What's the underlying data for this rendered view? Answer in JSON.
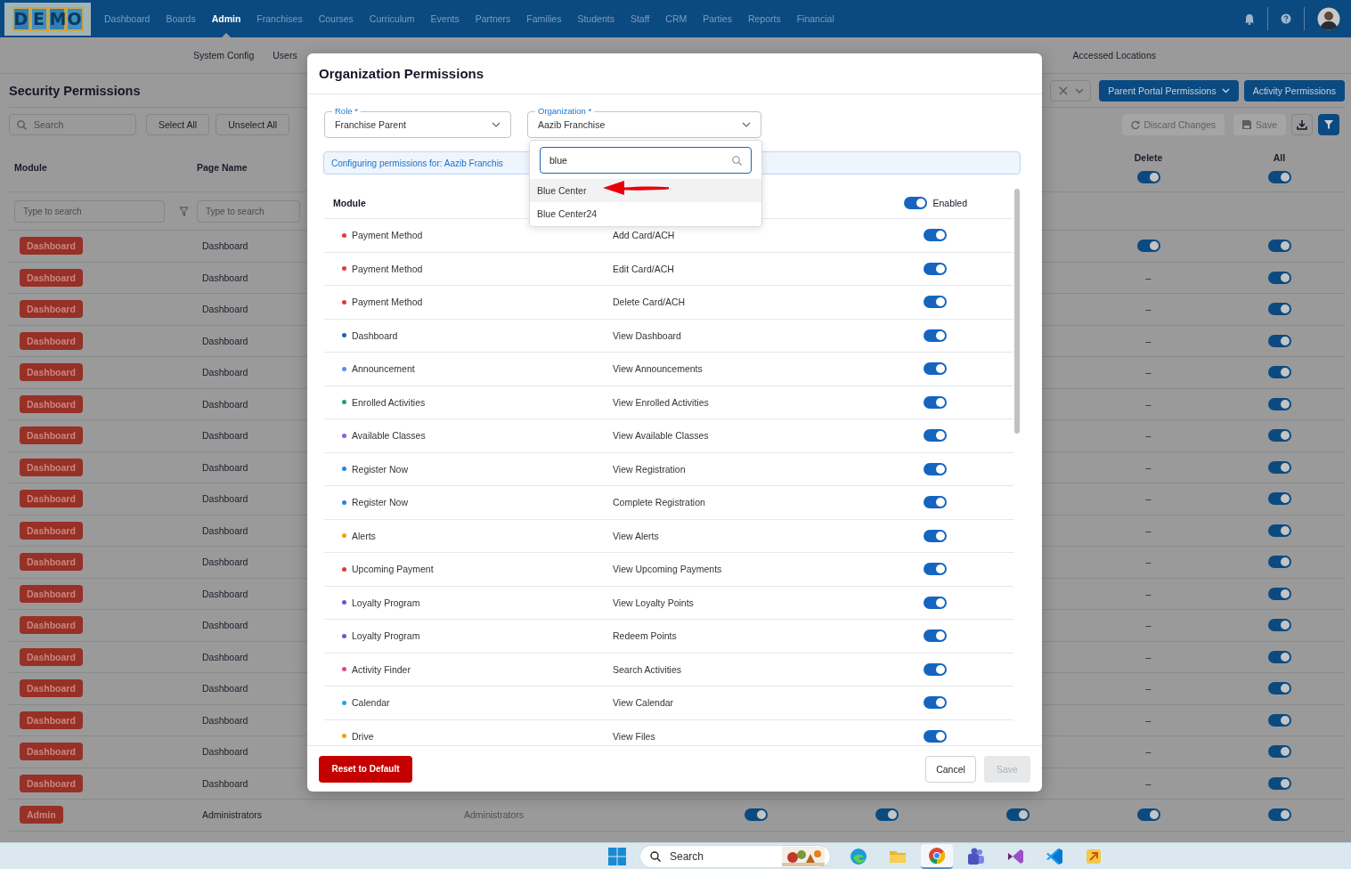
{
  "nav": {
    "logo": "DEMO",
    "items": [
      {
        "label": "Dashboard",
        "selected": false
      },
      {
        "label": "Boards",
        "selected": false
      },
      {
        "label": "Admin",
        "selected": true
      },
      {
        "label": "Franchises",
        "selected": false
      },
      {
        "label": "Courses",
        "selected": false
      },
      {
        "label": "Curriculum",
        "selected": false
      },
      {
        "label": "Events",
        "selected": false
      },
      {
        "label": "Partners",
        "selected": false
      },
      {
        "label": "Families",
        "selected": false
      },
      {
        "label": "Students",
        "selected": false
      },
      {
        "label": "Staff",
        "selected": false
      },
      {
        "label": "CRM",
        "selected": false
      },
      {
        "label": "Parties",
        "selected": false
      },
      {
        "label": "Reports",
        "selected": false
      },
      {
        "label": "Financial",
        "selected": false
      }
    ]
  },
  "subnav": {
    "left": [
      "System Config",
      "Users"
    ],
    "right": [
      "Accessed Locations"
    ]
  },
  "page": {
    "title": "Security Permissions",
    "header_buttons": [
      "Parent Portal Permissions",
      "Activity Permissions"
    ],
    "search": {
      "placeholder": "Search"
    },
    "select_all": "Select All",
    "unselect_all": "Unselect All",
    "discard": {
      "label": "Discard Changes",
      "disabled": true
    },
    "save": {
      "label": "Save",
      "disabled": true
    },
    "columns": [
      {
        "kind": "text",
        "label": "Module"
      },
      {
        "kind": "text",
        "label": "Page Name"
      },
      {
        "kind": "toggle",
        "label": "Delete",
        "on": true
      },
      {
        "kind": "toggle",
        "label": "All",
        "on": true
      }
    ],
    "column_filters": [
      {
        "placeholder": "Type to search"
      },
      {
        "placeholder": "Type to search"
      }
    ],
    "rows": [
      {
        "module": "Dashboard",
        "page": "Dashboard",
        "permissions": [
          {
            "kind": "toggle",
            "on": true
          },
          {
            "kind": "toggle",
            "on": true
          }
        ]
      },
      {
        "module": "Dashboard",
        "page": "Dashboard",
        "permissions": [
          {
            "kind": "text",
            "text": "–"
          },
          {
            "kind": "toggle",
            "on": true
          }
        ]
      },
      {
        "module": "Dashboard",
        "page": "Dashboard",
        "permissions": [
          {
            "kind": "text",
            "text": "–"
          },
          {
            "kind": "toggle",
            "on": true
          }
        ]
      },
      {
        "module": "Dashboard",
        "page": "Dashboard",
        "permissions": [
          {
            "kind": "text",
            "text": "–"
          },
          {
            "kind": "toggle",
            "on": true
          }
        ]
      },
      {
        "module": "Dashboard",
        "page": "Dashboard",
        "permissions": [
          {
            "kind": "text",
            "text": "–"
          },
          {
            "kind": "toggle",
            "on": true
          }
        ]
      },
      {
        "module": "Dashboard",
        "page": "Dashboard",
        "permissions": [
          {
            "kind": "text",
            "text": "–"
          },
          {
            "kind": "toggle",
            "on": true
          }
        ]
      },
      {
        "module": "Dashboard",
        "page": "Dashboard",
        "permissions": [
          {
            "kind": "text",
            "text": "–"
          },
          {
            "kind": "toggle",
            "on": true
          }
        ]
      },
      {
        "module": "Dashboard",
        "page": "Dashboard",
        "permissions": [
          {
            "kind": "text",
            "text": "–"
          },
          {
            "kind": "toggle",
            "on": true
          }
        ]
      },
      {
        "module": "Dashboard",
        "page": "Dashboard",
        "permissions": [
          {
            "kind": "text",
            "text": "–"
          },
          {
            "kind": "toggle",
            "on": true
          }
        ]
      },
      {
        "module": "Dashboard",
        "page": "Dashboard",
        "permissions": [
          {
            "kind": "text",
            "text": "–"
          },
          {
            "kind": "toggle",
            "on": true
          }
        ]
      },
      {
        "module": "Dashboard",
        "page": "Dashboard",
        "permissions": [
          {
            "kind": "text",
            "text": "–"
          },
          {
            "kind": "toggle",
            "on": true
          }
        ]
      },
      {
        "module": "Dashboard",
        "page": "Dashboard",
        "permissions": [
          {
            "kind": "text",
            "text": "–"
          },
          {
            "kind": "toggle",
            "on": true
          }
        ]
      },
      {
        "module": "Dashboard",
        "page": "Dashboard",
        "permissions": [
          {
            "kind": "text",
            "text": "–"
          },
          {
            "kind": "toggle",
            "on": true
          }
        ]
      },
      {
        "module": "Dashboard",
        "page": "Dashboard",
        "permissions": [
          {
            "kind": "text",
            "text": "–"
          },
          {
            "kind": "toggle",
            "on": true
          }
        ]
      },
      {
        "module": "Dashboard",
        "page": "Dashboard",
        "permissions": [
          {
            "kind": "text",
            "text": "–"
          },
          {
            "kind": "toggle",
            "on": true
          }
        ]
      },
      {
        "module": "Dashboard",
        "page": "Dashboard",
        "permissions": [
          {
            "kind": "text",
            "text": "–"
          },
          {
            "kind": "toggle",
            "on": true
          }
        ]
      },
      {
        "module": "Dashboard",
        "page": "Dashboard",
        "permissions": [
          {
            "kind": "text",
            "text": "–"
          },
          {
            "kind": "toggle",
            "on": true
          }
        ]
      },
      {
        "module": "Dashboard",
        "page": "Dashboard",
        "permissions": [
          {
            "kind": "text",
            "text": "–"
          },
          {
            "kind": "toggle",
            "on": true
          }
        ]
      },
      {
        "module": "Admin",
        "page": "Administrators",
        "column_3": "Administrators",
        "permissions": [
          {
            "kind": "toggle",
            "on": true
          },
          {
            "kind": "toggle",
            "on": true
          },
          {
            "kind": "toggle",
            "on": true
          },
          {
            "kind": "toggle",
            "on": true
          },
          {
            "kind": "toggle",
            "on": true
          }
        ]
      }
    ]
  },
  "modal": {
    "title": "Organization Permissions",
    "role": {
      "label": "Role *",
      "value": "Franchise Parent"
    },
    "organization": {
      "label": "Organization *",
      "value": "Aazib Franchise"
    },
    "banner": "Configuring permissions for: Aazib Franchis",
    "dropdown": {
      "query": "blue",
      "options": [
        {
          "label": "Blue Center",
          "selected": true
        },
        {
          "label": "Blue Center24",
          "selected": false
        }
      ]
    },
    "module_header": "Module",
    "enabled": {
      "label": "Enabled",
      "on": true
    },
    "rows": [
      {
        "module": "Payment Method",
        "color": "#e53935",
        "page": "Add Card/ACH",
        "on": true
      },
      {
        "module": "Payment Method",
        "color": "#e53935",
        "page": "Edit Card/ACH",
        "on": true
      },
      {
        "module": "Payment Method",
        "color": "#e53935",
        "page": "Delete Card/ACH",
        "on": true
      },
      {
        "module": "Dashboard",
        "color": "#1565c0",
        "page": "View Dashboard",
        "on": true
      },
      {
        "module": "Announcement",
        "color": "#5b8def",
        "page": "View Announcements",
        "on": true
      },
      {
        "module": "Enrolled Activities",
        "color": "#22a06b",
        "page": "View Enrolled Activities",
        "on": true
      },
      {
        "module": "Available Classes",
        "color": "#8e5cd9",
        "page": "View Available Classes",
        "on": true
      },
      {
        "module": "Register Now",
        "color": "#1e88e5",
        "page": "View Registration",
        "on": true
      },
      {
        "module": "Register Now",
        "color": "#1e88e5",
        "page": "Complete Registration",
        "on": true
      },
      {
        "module": "Alerts",
        "color": "#f59e0b",
        "page": "View Alerts",
        "on": true
      },
      {
        "module": "Upcoming Payment",
        "color": "#e53935",
        "page": "View Upcoming Payments",
        "on": true
      },
      {
        "module": "Loyalty Program",
        "color": "#5c5cd6",
        "page": "View Loyalty Points",
        "on": true
      },
      {
        "module": "Loyalty Program",
        "color": "#5c5cd6",
        "page": "Redeem Points",
        "on": true
      },
      {
        "module": "Activity Finder",
        "color": "#e84393",
        "page": "Search Activities",
        "on": true
      },
      {
        "module": "Calendar",
        "color": "#1ea7e1",
        "page": "View Calendar",
        "on": true
      },
      {
        "module": "Drive",
        "color": "#f59e0b",
        "page": "View Files",
        "on": true
      }
    ],
    "reset": "Reset to Default",
    "cancel": "Cancel",
    "save": {
      "label": "Save",
      "disabled": true
    }
  },
  "taskbar": {
    "search": {
      "placeholder": "Search"
    },
    "apps": [
      {
        "kind": "edge",
        "selected": false
      },
      {
        "kind": "folder",
        "selected": false
      },
      {
        "kind": "chrome",
        "selected": true
      },
      {
        "kind": "teams",
        "selected": false
      },
      {
        "kind": "studio",
        "selected": false
      },
      {
        "kind": "code",
        "selected": false
      },
      {
        "kind": "tool",
        "selected": false
      }
    ]
  }
}
